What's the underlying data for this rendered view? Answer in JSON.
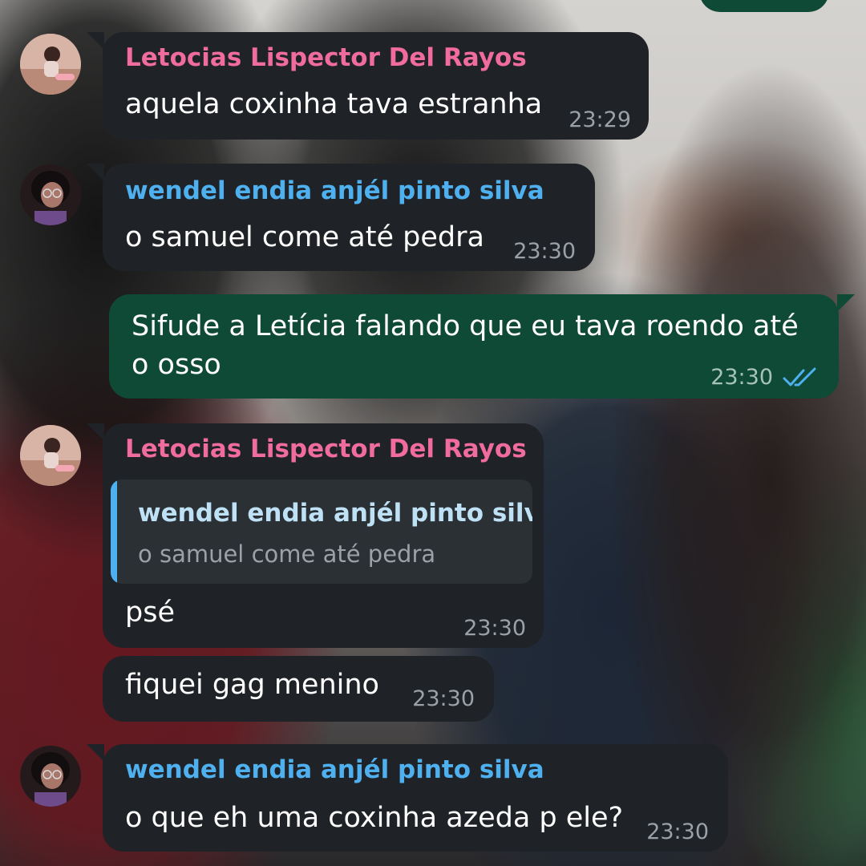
{
  "messages": [
    {
      "sender": "Letocias Lispector Del Rayos",
      "text": "aquela coxinha tava estranha",
      "time": "23:29"
    },
    {
      "sender": "wendel endia anjél pinto silva",
      "text": "o samuel come até pedra",
      "time": "23:30"
    },
    {
      "text_line1": "Sifude a Letícia falando que eu tava roendo até",
      "text_line2": "o osso",
      "time": "23:30",
      "status_icon": "double-check-icon"
    },
    {
      "sender": "Letocias Lispector Del Rayos",
      "quote_sender": "wendel endia anjél pinto silva",
      "quote_text": "o samuel come até pedra",
      "text": "psé",
      "time": "23:30"
    },
    {
      "text": "fiquei gag menino",
      "time": "23:30"
    },
    {
      "sender": "wendel endia anjél pinto silva",
      "text": "o que eh uma coxinha azeda p ele?",
      "time": "23:30"
    }
  ],
  "colors": {
    "incoming_bubble": "#1f2226",
    "outgoing_bubble": "#0f4a37",
    "sender_pink": "#f06b9e",
    "sender_blue": "#4fb0ef",
    "read_ticks": "#4fb0ef"
  }
}
